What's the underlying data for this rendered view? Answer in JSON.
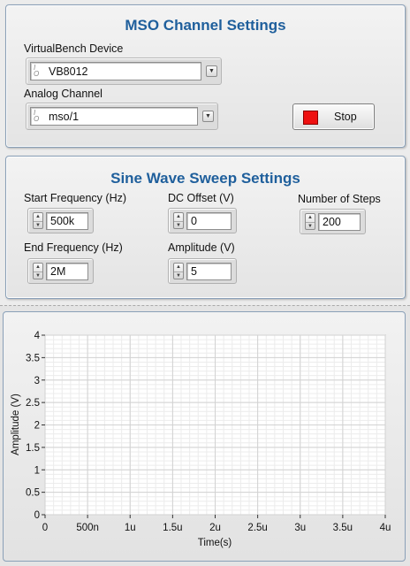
{
  "mso_panel": {
    "title": "MSO Channel Settings",
    "device_label": "VirtualBench Device",
    "device_value": "VB8012",
    "channel_label": "Analog Channel",
    "channel_value": "mso/1",
    "stop_label": "Stop"
  },
  "sweep_panel": {
    "title": "Sine Wave Sweep Settings",
    "start_freq_label": "Start Frequency (Hz)",
    "start_freq_value": "500k",
    "end_freq_label": "End Frequency (Hz)",
    "end_freq_value": "2M",
    "dc_offset_label": "DC Offset (V)",
    "dc_offset_value": "0",
    "amplitude_label": "Amplitude (V)",
    "amplitude_value": "5",
    "steps_label": "Number of Steps",
    "steps_value": "200"
  },
  "colors": {
    "title_blue": "#1f5f9c",
    "stop_led": "#ee1111",
    "panel_border": "#8aa0b8"
  },
  "chart_data": {
    "type": "line",
    "xlabel": "Time(s)",
    "ylabel": "Amplitude (V)",
    "xlim": [
      0,
      4e-06
    ],
    "ylim": [
      0,
      4
    ],
    "x_ticks": [
      "0",
      "500n",
      "1u",
      "1.5u",
      "2u",
      "2.5u",
      "3u",
      "3.5u",
      "4u"
    ],
    "y_ticks": [
      "0",
      "0.5",
      "1",
      "1.5",
      "2",
      "2.5",
      "3",
      "3.5",
      "4"
    ],
    "grid": true,
    "series": []
  }
}
